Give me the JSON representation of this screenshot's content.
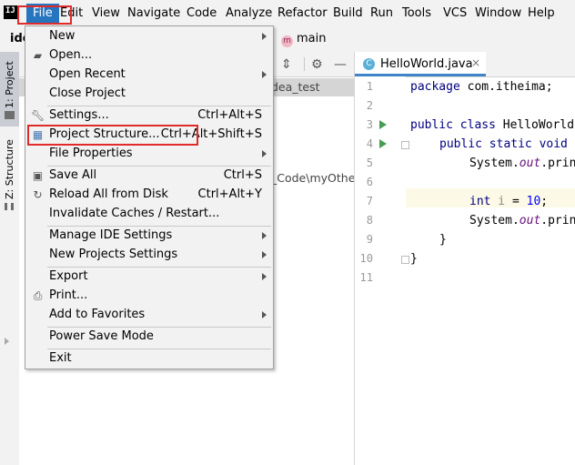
{
  "menubar": {
    "logo": "IJ",
    "items": [
      "File",
      "Edit",
      "View",
      "Navigate",
      "Code",
      "Analyze",
      "Refactor",
      "Build",
      "Run",
      "Tools",
      "VCS",
      "Window",
      "Help"
    ]
  },
  "navbar": {
    "project": "ide",
    "branch": "main"
  },
  "left_tabs": {
    "project": "1: Project",
    "structure": "Z: Structure"
  },
  "project_panel": {
    "selected_node": "dea_test",
    "path_fragment": "_Code\\myOther"
  },
  "editor": {
    "tab": "HelloWorld.java",
    "lines": [
      "1",
      "2",
      "3",
      "4",
      "5",
      "6",
      "7",
      "8",
      "9",
      "10",
      "11"
    ],
    "code": {
      "l1_kw": "package",
      "l1_rest": " com.itheima;",
      "l3_kw": "public class",
      "l3_rest": " HelloWorld",
      "l4_kw": "public static void",
      "l5_a": "System.",
      "l5_b": "out",
      "l5_c": ".prin",
      "l7_kw": "int",
      "l7_var": " i",
      "l7_eq": " = ",
      "l7_num": "10",
      "l7_end": ";",
      "l8_a": "System.",
      "l8_b": "out",
      "l8_c": ".prin",
      "l9": "}",
      "l10": "}"
    }
  },
  "file_menu": {
    "items": [
      {
        "label": "New",
        "shortcut": "",
        "submenu": true,
        "icon": ""
      },
      {
        "label": "Open...",
        "shortcut": "",
        "submenu": false,
        "icon": "folder-icon"
      },
      {
        "label": "Open Recent",
        "shortcut": "",
        "submenu": true,
        "icon": ""
      },
      {
        "label": "Close Project",
        "shortcut": "",
        "submenu": false,
        "icon": ""
      },
      {
        "label": "Settings...",
        "shortcut": "Ctrl+Alt+S",
        "submenu": false,
        "icon": "wrench-icon"
      },
      {
        "label": "Project Structure...",
        "shortcut": "Ctrl+Alt+Shift+S",
        "submenu": false,
        "icon": "project-structure-icon"
      },
      {
        "label": "File Properties",
        "shortcut": "",
        "submenu": true,
        "icon": ""
      },
      {
        "label": "Save All",
        "shortcut": "Ctrl+S",
        "submenu": false,
        "icon": "save-icon"
      },
      {
        "label": "Reload All from Disk",
        "shortcut": "Ctrl+Alt+Y",
        "submenu": false,
        "icon": "reload-icon"
      },
      {
        "label": "Invalidate Caches / Restart...",
        "shortcut": "",
        "submenu": false,
        "icon": ""
      },
      {
        "label": "Manage IDE Settings",
        "shortcut": "",
        "submenu": true,
        "icon": ""
      },
      {
        "label": "New Projects Settings",
        "shortcut": "",
        "submenu": true,
        "icon": ""
      },
      {
        "label": "Export",
        "shortcut": "",
        "submenu": true,
        "icon": ""
      },
      {
        "label": "Print...",
        "shortcut": "",
        "submenu": false,
        "icon": "print-icon"
      },
      {
        "label": "Add to Favorites",
        "shortcut": "",
        "submenu": true,
        "icon": ""
      },
      {
        "label": "Power Save Mode",
        "shortcut": "",
        "submenu": false,
        "icon": ""
      },
      {
        "label": "Exit",
        "shortcut": "",
        "submenu": false,
        "icon": ""
      }
    ]
  },
  "colors": {
    "menu_active": "#2675bf",
    "highlight_box": "#e02b2b",
    "tab_underline": "#4083c9",
    "run_arrow": "#499c54"
  }
}
